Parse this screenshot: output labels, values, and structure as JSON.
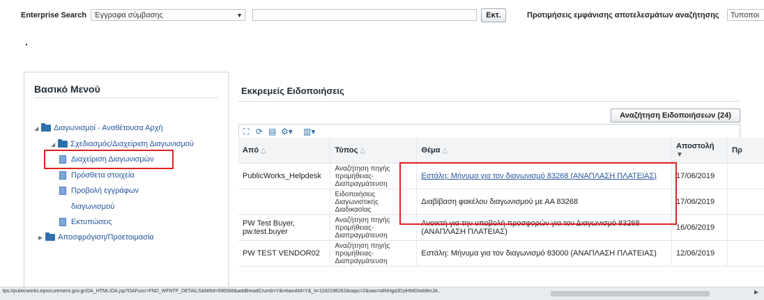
{
  "search": {
    "label": "Enterprise Search",
    "category_value": "Έγγραφα σύμβασης",
    "query_value": "",
    "go_label": "Εκτ.",
    "preferences_label": "Προτιμήσεις εμφάνισης αποτελεσμάτων αναζήτησης",
    "type_value": "Τυποποι"
  },
  "misc": {
    "dot": "."
  },
  "menu": {
    "title": "Βασικό Μενού",
    "items": [
      {
        "label": "Διαγωνισμοί - Αναθέτουσα Αρχή",
        "kind": "folder",
        "expanded": true
      },
      {
        "label": "Σχεδιασμός/Διαχείριση Διαγωνισμού",
        "kind": "folder",
        "expanded": true
      },
      {
        "label": "Διαχείριση Διαγωνισμών",
        "kind": "doc",
        "highlighted": true
      },
      {
        "label": "Πρόσθετα στοιχεία",
        "kind": "doc"
      },
      {
        "label": "Προβολή εγγράφων",
        "kind": "doc"
      },
      {
        "label": "διαγωνισμού",
        "kind": "continuation"
      },
      {
        "label": "Εκτυπώσεις",
        "kind": "doc"
      },
      {
        "label": "Αποσφράγιση/Προετοιμασία",
        "kind": "folder",
        "expanded": false
      }
    ]
  },
  "notifications": {
    "title": "Εκκρεμείς Ειδοποιήσεις",
    "search_button": "Αναζήτηση Ειδοποιήσεων (24)",
    "toolbar_icons": [
      "detach-icon",
      "refresh-icon",
      "export-icon",
      "settings-icon",
      "view-icon"
    ],
    "columns": [
      "Από",
      "Τύπος",
      "Θέμα",
      "Αποστολή",
      "Πρ"
    ],
    "rows": [
      {
        "from": "PublicWorks_Helpdesk",
        "type": "Αναζήτηση πηγής προμήθειας-Διαπραγμάτευση",
        "subject": "Εστάλη: Μήνυμα για τον διαγωνισμό 83268 (ΑΝΑΠΛΑΣΗ ΠΛΑΤΕΙΑΣ)",
        "subject_link": true,
        "sent": "17/06/2019"
      },
      {
        "from": "",
        "type": "Ειδοποιήσεις Διαγωνιστικής Διαδικασίας",
        "subject": "Διαβίβαση φακέλου διαγωνισμού με ΑΑ 83268",
        "subject_link": false,
        "sent": "17/06/2019"
      },
      {
        "from": "PW Test Buyer, pw.test.buyer",
        "type": "Αναζήτηση πηγής προμήθειας-Διαπραγμάτευση",
        "subject": "Ανοικτή για την υποβολή προσφορών για τον Διαγωνισμό 83268 (ΑΝΑΠΛΑΣΗ ΠΛΑΤΕΙΑΣ)",
        "subject_link": false,
        "sent": "16/06/2019"
      },
      {
        "from": "PW TEST VENDOR02",
        "type": "Αναζήτηση πηγής προμήθειας-Διαπραγμάτευση",
        "subject": "Εστάλη: Μήνυμα για τον διαγωνισμό 83000 (ΑΝΑΠΛΑΣΗ ΠΛΑΤΕΙΑΣ)",
        "subject_link": false,
        "sent": "12/06/2019"
      }
    ]
  },
  "status": {
    "url": "tps://publicworks.eprocurement.gov.gr/OA_HTML/OA.jsp?OAFunc=FND_WFNTF_DETAILS&NtfId=696588&addBreadCrumb=Y&retainAM=Y&_ti=1192198262&oapc=2&oas=ollNHgdJDylHfdGfwb9mJA.."
  },
  "colors": {
    "highlight": "#e02020",
    "link": "#23549b",
    "folder": "#2e6fa8"
  }
}
